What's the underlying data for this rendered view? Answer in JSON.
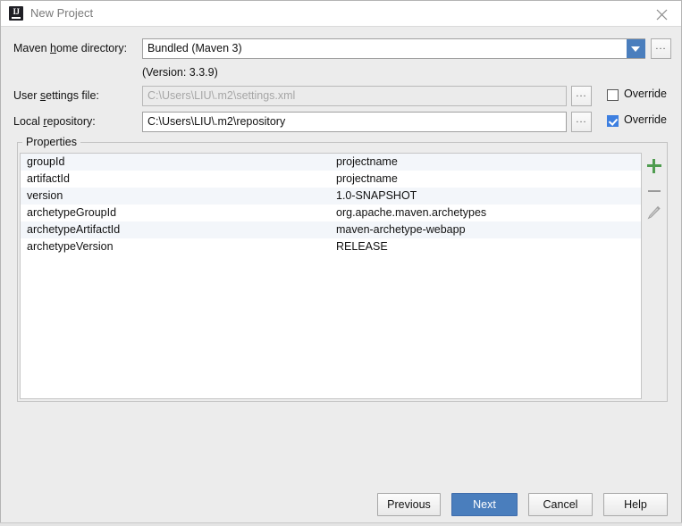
{
  "window": {
    "title": "New Project",
    "app_icon": "intellij-idea-icon",
    "close_icon": "close-icon"
  },
  "form": {
    "maven_home": {
      "label_pre": "Maven ",
      "label_mnemonic": "h",
      "label_post": "ome directory:",
      "value": "Bundled (Maven 3)",
      "dropdown_icon": "chevron-down-icon",
      "browse_label": "...",
      "version_note": "(Version: 3.3.9)"
    },
    "user_settings": {
      "label_pre": "User ",
      "label_mnemonic": "s",
      "label_post": "ettings file:",
      "value": "C:\\Users\\LIU\\.m2\\settings.xml",
      "browse_label": "...",
      "override_label": "Override",
      "override_checked": false,
      "disabled": true
    },
    "local_repository": {
      "label_pre": "Local ",
      "label_mnemonic": "r",
      "label_post": "epository:",
      "value": "C:\\Users\\LIU\\.m2\\repository",
      "browse_label": "...",
      "override_label": "Override",
      "override_checked": true,
      "disabled": false
    }
  },
  "properties": {
    "group_title": "Properties",
    "rows": [
      {
        "name": "groupId",
        "value": "projectname"
      },
      {
        "name": "artifactId",
        "value": "projectname"
      },
      {
        "name": "version",
        "value": "1.0-SNAPSHOT"
      },
      {
        "name": "archetypeGroupId",
        "value": "org.apache.maven.archetypes"
      },
      {
        "name": "archetypeArtifactId",
        "value": "maven-archetype-webapp"
      },
      {
        "name": "archetypeVersion",
        "value": "RELEASE"
      }
    ],
    "toolbar": {
      "add_icon": "plus-icon",
      "remove_icon": "minus-icon",
      "edit_icon": "pencil-icon"
    }
  },
  "footer": {
    "previous_label": "Previous",
    "next_label": "Next",
    "cancel_label": "Cancel",
    "help_label": "Help"
  },
  "colors": {
    "accent_blue": "#4a7ebd",
    "checkbox_blue": "#3d7fe0",
    "add_green": "#4f9c4f",
    "row_stripe": "#f3f6fa",
    "dialog_bg": "#ececec"
  }
}
